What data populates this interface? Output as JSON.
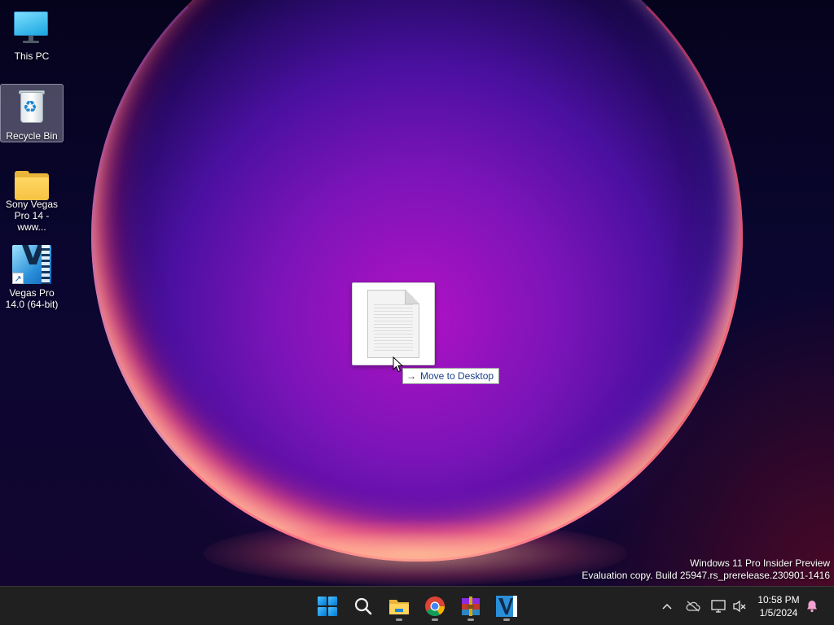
{
  "desktop": {
    "icons": [
      {
        "label": "This PC",
        "icon": "this-pc-icon"
      },
      {
        "label": "Recycle Bin",
        "icon": "recycle-bin-icon"
      },
      {
        "label": "Sony Vegas Pro 14 - www...",
        "icon": "folder-icon"
      },
      {
        "label": "Vegas Pro 14.0 (64-bit)",
        "icon": "vegas-pro-icon"
      }
    ],
    "drag_tooltip": {
      "arrow": "→",
      "text": "Move to Desktop"
    },
    "watermark": {
      "line1": "Windows 11 Pro Insider Preview",
      "line2": "Evaluation copy. Build 25947.rs_prerelease.230901-1416"
    }
  },
  "taskbar": {
    "apps": [
      {
        "name": "Start",
        "icon": "windows-start-icon"
      },
      {
        "name": "Search",
        "icon": "search-icon"
      },
      {
        "name": "File Explorer",
        "icon": "file-explorer-icon"
      },
      {
        "name": "Google Chrome",
        "icon": "chrome-icon"
      },
      {
        "name": "WinRAR",
        "icon": "winrar-icon"
      },
      {
        "name": "Vegas Pro",
        "icon": "vegas-pro-icon"
      }
    ],
    "tray": {
      "time": "10:58 PM",
      "date": "1/5/2024"
    }
  },
  "colors": {
    "taskbar": "#202020",
    "accent": "#0078d4",
    "tooltip_text": "#1a3e8c"
  }
}
